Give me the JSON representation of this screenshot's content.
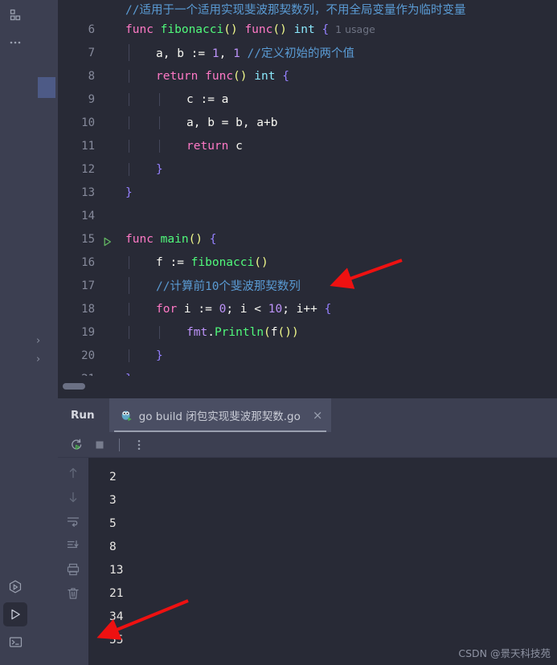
{
  "window": {
    "theme_bg": "#282a36",
    "panel_bg": "#3c3f51",
    "accent_green": "#50fa7b",
    "arrow_color": "#ee1111"
  },
  "left_toolstrip": {
    "top_icons": [
      {
        "name": "structure-icon",
        "glyph": "blocks"
      },
      {
        "name": "more-tool-windows-icon",
        "glyph": "..."
      }
    ],
    "bottom_icons": [
      {
        "name": "run-with-coverage-icon",
        "glyph": "hex-play"
      },
      {
        "name": "run-tool-window-icon",
        "glyph": "play"
      },
      {
        "name": "terminal-icon",
        "glyph": "terminal"
      }
    ]
  },
  "narrow_sidebar": {
    "chevrons": [
      "›",
      "›"
    ]
  },
  "editor": {
    "lines": [
      {
        "number": "",
        "clipped": true,
        "tokens": [
          {
            "t": "//适用于一个适用实现斐波那契数列，不用全局变量作为临时变量",
            "c": "cmt"
          }
        ]
      },
      {
        "number": "6",
        "indent": 0,
        "tokens": [
          {
            "t": "func",
            "c": "k"
          },
          {
            "t": " ",
            "c": "id"
          },
          {
            "t": "fibonacci",
            "c": "fn"
          },
          {
            "t": "()",
            "c": "par"
          },
          {
            "t": " ",
            "c": "id"
          },
          {
            "t": "func",
            "c": "k"
          },
          {
            "t": "()",
            "c": "par"
          },
          {
            "t": " ",
            "c": "id"
          },
          {
            "t": "int",
            "c": "typ"
          },
          {
            "t": " ",
            "c": "id"
          },
          {
            "t": "{",
            "c": "br"
          },
          {
            "t": "  1 usage",
            "c": "usage"
          }
        ]
      },
      {
        "number": "7",
        "indent": 1,
        "tokens": [
          {
            "t": "a, b ",
            "c": "id"
          },
          {
            "t": ":= ",
            "c": "id"
          },
          {
            "t": "1",
            "c": "num"
          },
          {
            "t": ", ",
            "c": "id"
          },
          {
            "t": "1",
            "c": "num"
          },
          {
            "t": " ",
            "c": "id"
          },
          {
            "t": "//定义初始的两个值",
            "c": "cmt"
          }
        ]
      },
      {
        "number": "8",
        "indent": 1,
        "tokens": [
          {
            "t": "return",
            "c": "k"
          },
          {
            "t": " ",
            "c": "id"
          },
          {
            "t": "func",
            "c": "k"
          },
          {
            "t": "()",
            "c": "par"
          },
          {
            "t": " ",
            "c": "id"
          },
          {
            "t": "int",
            "c": "typ"
          },
          {
            "t": " ",
            "c": "id"
          },
          {
            "t": "{",
            "c": "br"
          }
        ]
      },
      {
        "number": "9",
        "indent": 2,
        "tokens": [
          {
            "t": "c := a",
            "c": "id"
          }
        ]
      },
      {
        "number": "10",
        "indent": 2,
        "tokens": [
          {
            "t": "a, b = b, a+b",
            "c": "id"
          }
        ]
      },
      {
        "number": "11",
        "indent": 2,
        "tokens": [
          {
            "t": "return",
            "c": "k"
          },
          {
            "t": " c",
            "c": "id"
          }
        ]
      },
      {
        "number": "12",
        "indent": 1,
        "tokens": [
          {
            "t": "}",
            "c": "br"
          }
        ]
      },
      {
        "number": "13",
        "indent": 0,
        "tokens": [
          {
            "t": "}",
            "c": "br"
          }
        ]
      },
      {
        "number": "14",
        "indent": 0,
        "tokens": []
      },
      {
        "number": "15",
        "indent": 0,
        "run_marker": true,
        "tokens": [
          {
            "t": "func",
            "c": "k"
          },
          {
            "t": " ",
            "c": "id"
          },
          {
            "t": "main",
            "c": "fn"
          },
          {
            "t": "()",
            "c": "par"
          },
          {
            "t": " ",
            "c": "id"
          },
          {
            "t": "{",
            "c": "br"
          }
        ]
      },
      {
        "number": "16",
        "indent": 1,
        "tokens": [
          {
            "t": "f := ",
            "c": "id"
          },
          {
            "t": "fibonacci",
            "c": "fn"
          },
          {
            "t": "()",
            "c": "par"
          }
        ]
      },
      {
        "number": "17",
        "indent": 1,
        "tokens": [
          {
            "t": "//计算前10个斐波那契数列",
            "c": "cmt"
          }
        ]
      },
      {
        "number": "18",
        "indent": 1,
        "tokens": [
          {
            "t": "for",
            "c": "k"
          },
          {
            "t": " i := ",
            "c": "id"
          },
          {
            "t": "0",
            "c": "num"
          },
          {
            "t": "; i < ",
            "c": "id"
          },
          {
            "t": "10",
            "c": "num"
          },
          {
            "t": "; i++ ",
            "c": "id"
          },
          {
            "t": "{",
            "c": "br"
          }
        ]
      },
      {
        "number": "19",
        "indent": 2,
        "tokens": [
          {
            "t": "fmt",
            "c": "pkg"
          },
          {
            "t": ".",
            "c": "id"
          },
          {
            "t": "Println",
            "c": "fn"
          },
          {
            "t": "(",
            "c": "par"
          },
          {
            "t": "f",
            "c": "id"
          },
          {
            "t": "()",
            "c": "par"
          },
          {
            "t": ")",
            "c": "par"
          }
        ]
      },
      {
        "number": "20",
        "indent": 1,
        "tokens": [
          {
            "t": "}",
            "c": "br"
          }
        ]
      },
      {
        "number": "21",
        "indent": 0,
        "tokens": [
          {
            "t": "}",
            "c": "br"
          }
        ]
      }
    ]
  },
  "run_window": {
    "title": "Run",
    "tab": {
      "label": "go build 闭包实现斐波那契数.go",
      "close": "×",
      "icon": "go-gopher-run-icon"
    },
    "toolbar": [
      {
        "name": "rerun-icon"
      },
      {
        "name": "stop-icon"
      },
      {
        "name": "more-options-icon"
      }
    ],
    "sidebar_icons": [
      {
        "name": "previous-occurrence-icon",
        "glyph": "↑"
      },
      {
        "name": "next-occurrence-icon",
        "glyph": "↓"
      },
      {
        "name": "soft-wrap-icon"
      },
      {
        "name": "scroll-to-end-icon"
      },
      {
        "name": "print-icon"
      },
      {
        "name": "clear-all-icon"
      }
    ],
    "console_output": [
      "2",
      "3",
      "5",
      "8",
      "13",
      "21",
      "34",
      "55"
    ]
  },
  "watermark": "CSDN @景天科技苑"
}
